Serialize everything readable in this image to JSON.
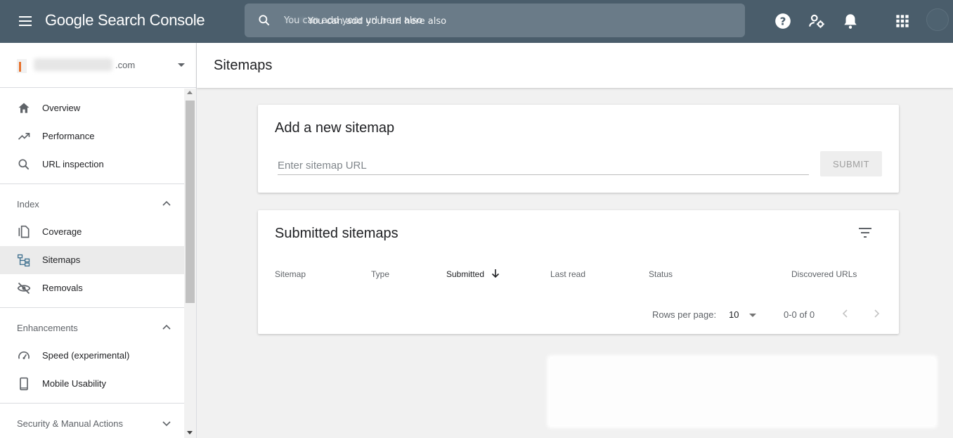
{
  "topbar": {
    "logo": "Google Search Console",
    "search": {
      "placeholder": "You can add your url here also",
      "blurred_hint": "in       rn      m"
    },
    "icons": [
      "menu-icon",
      "search-icon",
      "help-icon",
      "users-settings-icon",
      "notifications-icon",
      "apps-icon",
      "account-avatar"
    ]
  },
  "sidebar": {
    "property": {
      "name": ".com"
    },
    "items": [
      {
        "label": "Overview",
        "icon": "home-icon"
      },
      {
        "label": "Performance",
        "icon": "trending-up-icon"
      },
      {
        "label": "URL inspection",
        "icon": "search-icon"
      }
    ],
    "sections": [
      {
        "title": "Index",
        "items": [
          {
            "label": "Coverage",
            "icon": "copy-icon"
          },
          {
            "label": "Sitemaps",
            "icon": "sitemap-icon",
            "active": true
          },
          {
            "label": "Removals",
            "icon": "visibility-off-icon"
          }
        ]
      },
      {
        "title": "Enhancements",
        "items": [
          {
            "label": "Speed (experimental)",
            "icon": "speedometer-icon"
          },
          {
            "label": "Mobile Usability",
            "icon": "smartphone-icon"
          }
        ]
      },
      {
        "title": "Security & Manual Actions",
        "items": []
      }
    ]
  },
  "main": {
    "page_title": "Sitemaps",
    "add_card": {
      "title": "Add a new sitemap",
      "input_placeholder": "Enter sitemap URL",
      "submit_label": "SUBMIT"
    },
    "submitted_card": {
      "title": "Submitted sitemaps",
      "columns": [
        "Sitemap",
        "Type",
        "Submitted",
        "Last read",
        "Status",
        "Discovered URLs"
      ],
      "sorted_column": "Submitted",
      "rows": [],
      "pagination": {
        "rows_per_page_label": "Rows per page:",
        "rows_per_page": "10",
        "range": "0-0 of 0"
      }
    }
  },
  "colors": {
    "topbar": "#4a5d6b",
    "searchbox": "#6a7b88",
    "active_nav": "#ebebeb",
    "background": "#f1f1f1"
  }
}
